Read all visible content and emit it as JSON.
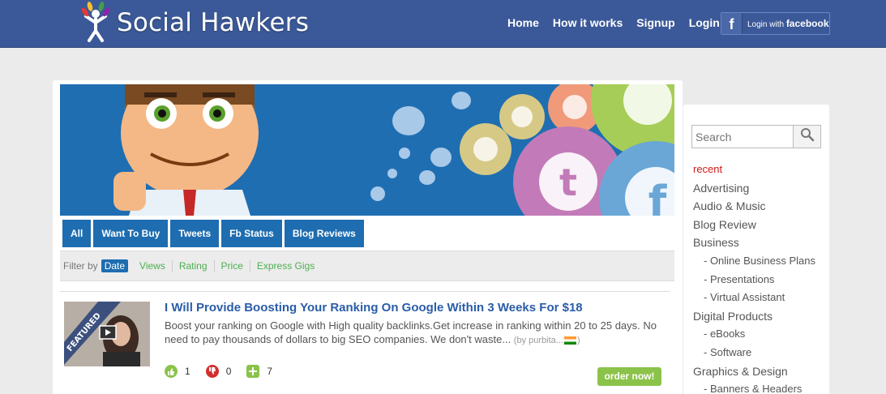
{
  "header": {
    "brand": "Social Hawkers",
    "nav": [
      "Home",
      "How it works",
      "Signup",
      "Login"
    ],
    "fb_login_prefix": "Login with",
    "fb_login_brand": "facebook"
  },
  "tabs": [
    "All",
    "Want To Buy",
    "Tweets",
    "Fb Status",
    "Blog Reviews"
  ],
  "filter": {
    "label": "Filter by",
    "active": "Date",
    "options": [
      "Views",
      "Rating",
      "Price",
      "Express Gigs"
    ]
  },
  "gig": {
    "ribbon": "FEATURED",
    "title": "I Will Provide Boosting Your Ranking On Google Within 3 Weeks For $18",
    "description": "Boost your ranking on Google with High quality backlinks.Get increase in ranking within 20 to 25 days. No need to pay thousands of dollars to big SEO companies. We don't waste...",
    "by": "(by purbita...",
    "by_close": ")",
    "likes": "1",
    "dislikes": "0",
    "adds": "7",
    "order_label": "order now!"
  },
  "sidebar": {
    "search_placeholder": "Search",
    "current": "recent",
    "categories": [
      {
        "label": "Advertising",
        "sub": false
      },
      {
        "label": "Audio & Music",
        "sub": false
      },
      {
        "label": "Blog Review",
        "sub": false
      },
      {
        "label": "Business",
        "sub": false
      },
      {
        "label": "- Online Business Plans",
        "sub": true
      },
      {
        "label": "- Presentations",
        "sub": true
      },
      {
        "label": "- Virtual Assistant",
        "sub": true
      },
      {
        "label": "Digital Products",
        "sub": false
      },
      {
        "label": "- eBooks",
        "sub": true
      },
      {
        "label": "- Software",
        "sub": true
      },
      {
        "label": "Graphics & Design",
        "sub": false
      },
      {
        "label": "- Banners & Headers",
        "sub": true
      }
    ]
  },
  "colors": {
    "brand_blue": "#3b5998",
    "tab_blue": "#1e6db0",
    "green": "#8bc34a",
    "red": "#d21919"
  }
}
